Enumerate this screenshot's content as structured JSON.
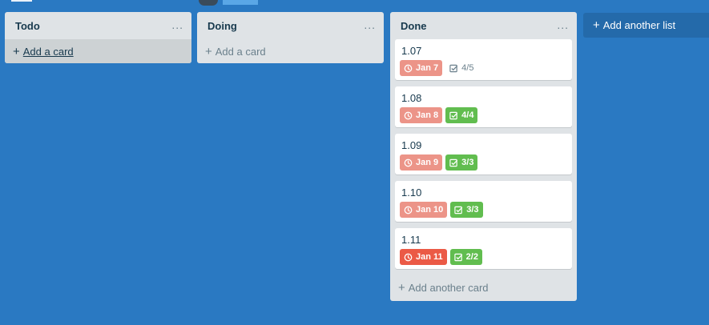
{
  "lists": [
    {
      "title": "Todo",
      "add_label": "Add a card",
      "cards": []
    },
    {
      "title": "Doing",
      "add_label": "Add a card",
      "cards": []
    },
    {
      "title": "Done",
      "add_label": "Add another card",
      "cards": [
        {
          "title": "1.07",
          "due": "Jan 7",
          "checklist": "4/5"
        },
        {
          "title": "1.08",
          "due": "Jan 8",
          "checklist": "4/4"
        },
        {
          "title": "1.09",
          "due": "Jan 9",
          "checklist": "3/3"
        },
        {
          "title": "1.10",
          "due": "Jan 10",
          "checklist": "3/3"
        },
        {
          "title": "1.11",
          "due": "Jan 11",
          "checklist": "2/2"
        }
      ]
    }
  ],
  "menu_icon": "...",
  "add_list_label": "Add another list",
  "colors": {
    "board_bg": "#2a79c2",
    "list_bg": "#dfe3e6",
    "due_soon": "#ec9488",
    "due_overdue": "#eb5a46",
    "checklist_complete": "#61bd4f"
  }
}
